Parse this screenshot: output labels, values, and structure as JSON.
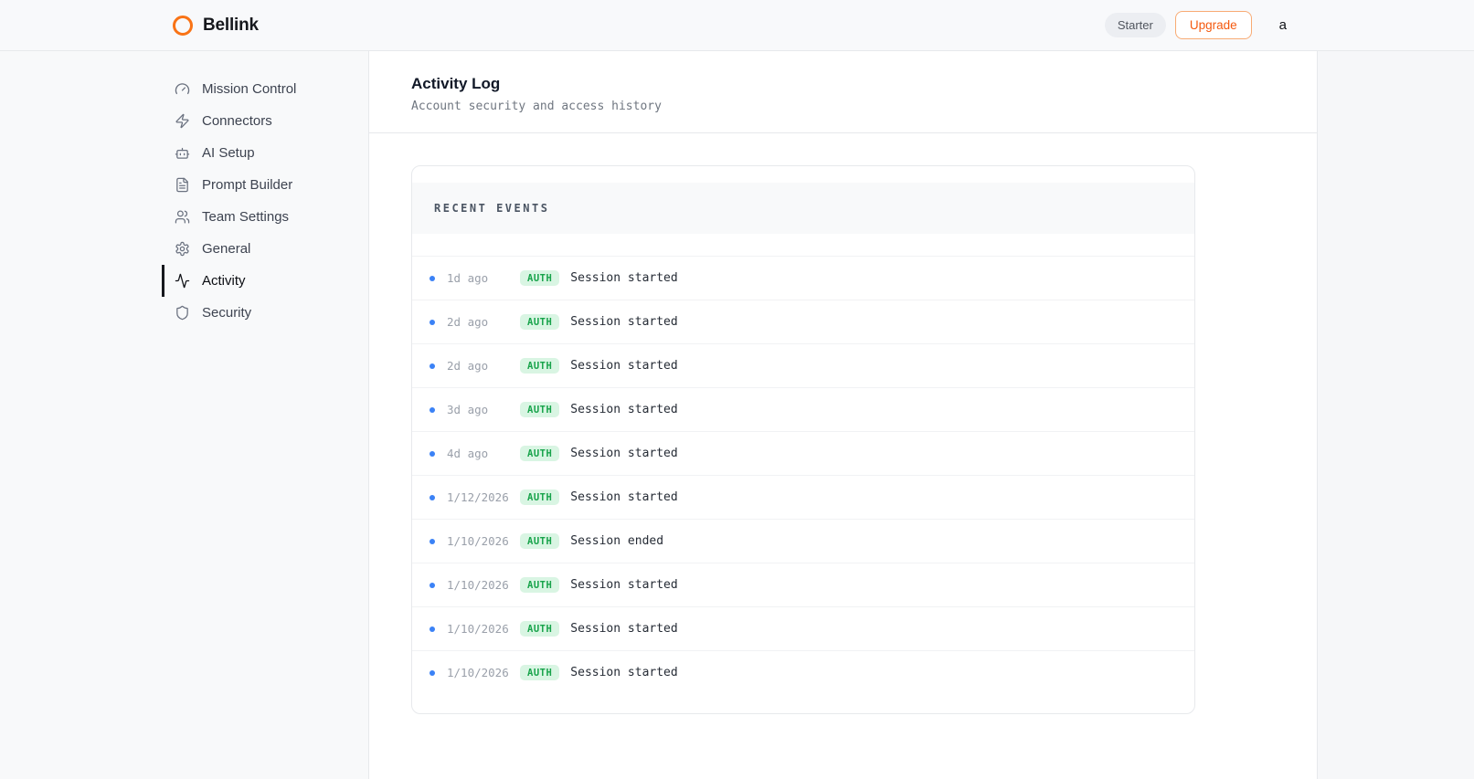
{
  "brand": {
    "name": "Bellink"
  },
  "header": {
    "plan_badge": "Starter",
    "upgrade_label": "Upgrade",
    "avatar_initial": "a"
  },
  "sidebar": {
    "items": [
      {
        "label": "Mission Control",
        "icon": "gauge-icon",
        "active": false
      },
      {
        "label": "Connectors",
        "icon": "zap-icon",
        "active": false
      },
      {
        "label": "AI Setup",
        "icon": "bot-icon",
        "active": false
      },
      {
        "label": "Prompt Builder",
        "icon": "document-icon",
        "active": false
      },
      {
        "label": "Team Settings",
        "icon": "users-icon",
        "active": false
      },
      {
        "label": "General",
        "icon": "gear-icon",
        "active": false
      },
      {
        "label": "Activity",
        "icon": "activity-pulse-icon",
        "active": true
      },
      {
        "label": "Security",
        "icon": "shield-icon",
        "active": false
      }
    ]
  },
  "page": {
    "title": "Activity Log",
    "subtitle": "Account security and access history"
  },
  "events_card": {
    "header": "RECENT EVENTS",
    "events": [
      {
        "time": "1d ago",
        "badge": "AUTH",
        "text": "Session started"
      },
      {
        "time": "2d ago",
        "badge": "AUTH",
        "text": "Session started"
      },
      {
        "time": "2d ago",
        "badge": "AUTH",
        "text": "Session started"
      },
      {
        "time": "3d ago",
        "badge": "AUTH",
        "text": "Session started"
      },
      {
        "time": "4d ago",
        "badge": "AUTH",
        "text": "Session started"
      },
      {
        "time": "1/12/2026",
        "badge": "AUTH",
        "text": "Session started"
      },
      {
        "time": "1/10/2026",
        "badge": "AUTH",
        "text": "Session ended"
      },
      {
        "time": "1/10/2026",
        "badge": "AUTH",
        "text": "Session started"
      },
      {
        "time": "1/10/2026",
        "badge": "AUTH",
        "text": "Session started"
      },
      {
        "time": "1/10/2026",
        "badge": "AUTH",
        "text": "Session started"
      }
    ]
  },
  "colors": {
    "accent_orange": "#f97316",
    "upgrade_text": "#f4590e",
    "badge_green_text": "#17a34a",
    "badge_green_bg": "#d9f5e3",
    "event_dot_blue": "#3b82f6",
    "active_nav_bar": "#16181d"
  }
}
